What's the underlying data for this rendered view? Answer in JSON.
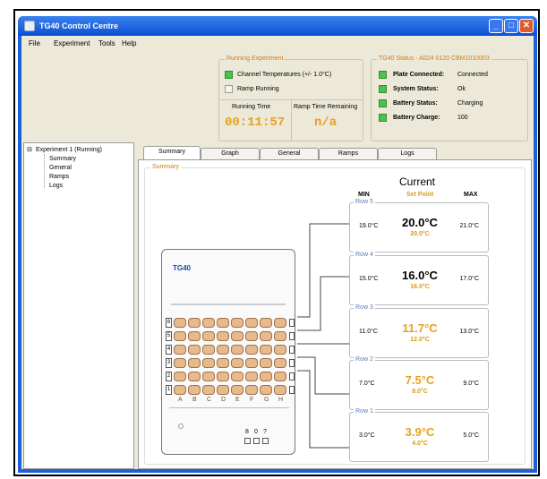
{
  "window": {
    "title": "TG40 Control Centre",
    "minimize": "_",
    "maximize": "□",
    "close": "✕"
  },
  "menu": [
    "File",
    "Experiment",
    "Tools",
    "Help"
  ],
  "running_experiment": {
    "legend": "Running Experiment",
    "items": [
      {
        "label": "Channel Temperatures (+/- 1.0°C)",
        "on": true
      },
      {
        "label": "Ramp Running",
        "on": false
      }
    ],
    "running_time_label": "Running Time",
    "running_time": "00:11:57",
    "ramp_remaining_label": "Ramp Time Remaining",
    "ramp_remaining": "n/a"
  },
  "status": {
    "legend": "TG40 Status - A024 0120 CBM1010003",
    "items": [
      {
        "label": "Plate Connected:",
        "value": "Connected"
      },
      {
        "label": "System Status:",
        "value": "Ok"
      },
      {
        "label": "Battery Status:",
        "value": "Charging"
      },
      {
        "label": "Battery Charge:",
        "value": "100"
      }
    ]
  },
  "tree": {
    "root": "Experiment 1 (Running)",
    "toggle": "⊟",
    "children": [
      "Summary",
      "General",
      "Ramps",
      "Logs"
    ]
  },
  "tabs": [
    "Summary",
    "Graph",
    "General",
    "Ramps",
    "Logs"
  ],
  "summary": {
    "legend": "Summary",
    "device_label": "TG40",
    "header_min": "MIN",
    "header_current": "Current",
    "header_setpoint": "Set Point",
    "header_max": "MAX",
    "row_numbers": [
      "6",
      "5",
      "4",
      "3",
      "2",
      "1"
    ],
    "columns": [
      "A",
      "B",
      "C",
      "D",
      "E",
      "F",
      "G",
      "H"
    ],
    "ports": [
      "8",
      "0",
      "?"
    ],
    "rows": [
      {
        "name": "Row 5",
        "min": "19.0°C",
        "current": "20.0°C",
        "setpoint": "20.0°C",
        "max": "21.0°C",
        "color": "#000000"
      },
      {
        "name": "Row 4",
        "min": "15.0°C",
        "current": "16.0°C",
        "setpoint": "16.0°C",
        "max": "17.0°C",
        "color": "#000000"
      },
      {
        "name": "Row 3",
        "min": "11.0°C",
        "current": "11.7°C",
        "setpoint": "12.0°C",
        "max": "13.0°C",
        "color": "#e8a020"
      },
      {
        "name": "Row 2",
        "min": "7.0°C",
        "current": "7.5°C",
        "setpoint": "8.0°C",
        "max": "9.0°C",
        "color": "#e8a020"
      },
      {
        "name": "Row 1",
        "min": "3.0°C",
        "current": "3.9°C",
        "setpoint": "4.0°C",
        "max": "5.0°C",
        "color": "#e8a020"
      }
    ]
  },
  "colors": {
    "titlebar": "#0b4fd2",
    "accent": "#e8a020",
    "led_on": "#4bc24b",
    "well": "#e8b98a"
  }
}
